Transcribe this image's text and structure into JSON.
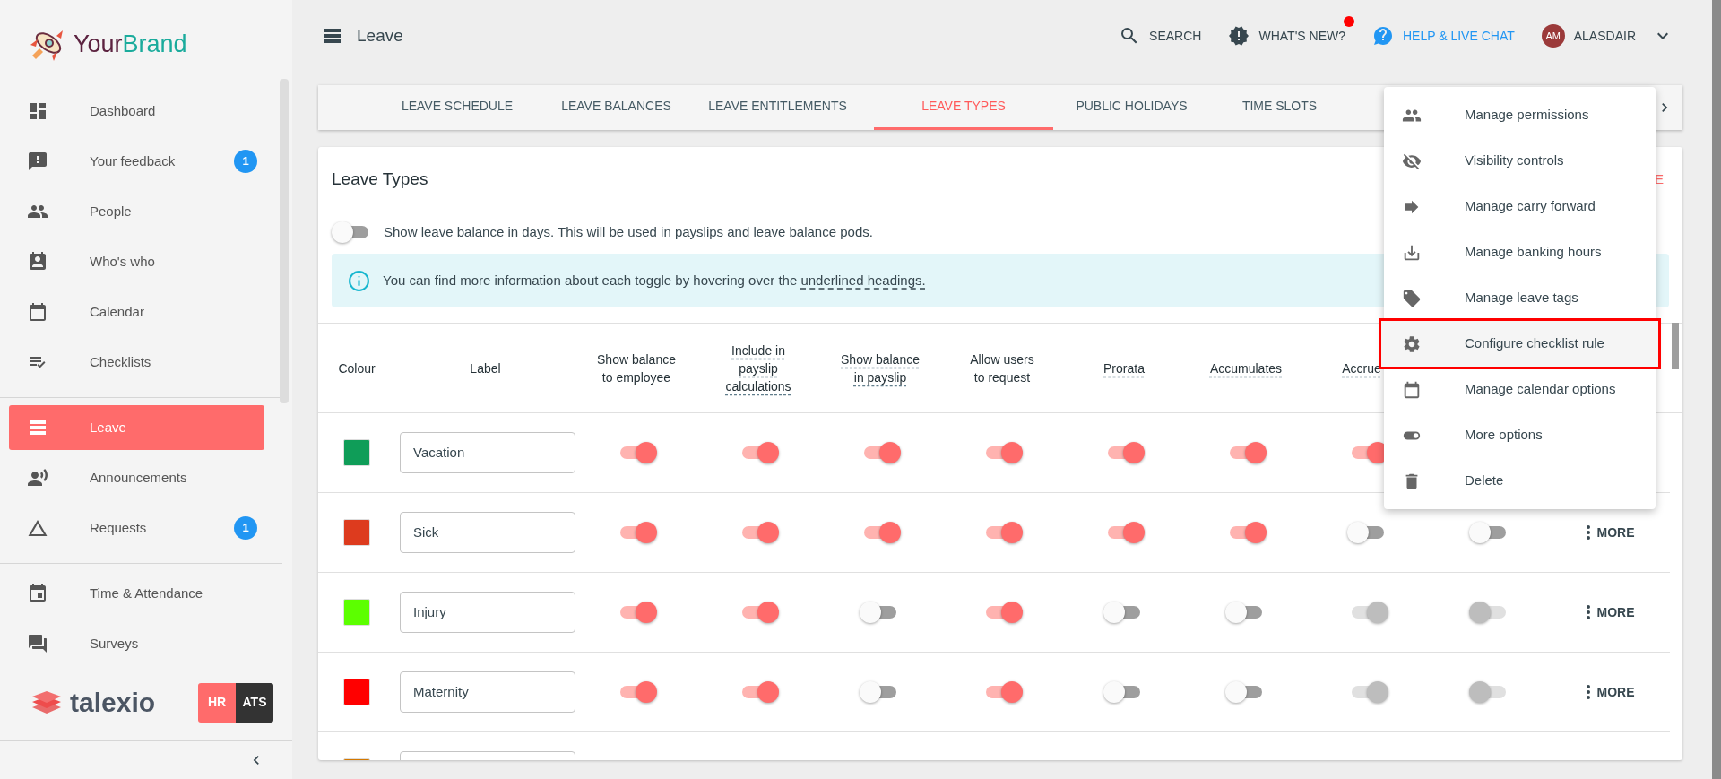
{
  "brand": {
    "name_first": "Your",
    "name_second": "Brand"
  },
  "sidebar": {
    "groups": [
      [
        {
          "label": "Dashboard",
          "selected": false
        },
        {
          "label": "Your feedback",
          "selected": false,
          "badge": "1"
        },
        {
          "label": "People",
          "selected": false
        },
        {
          "label": "Who's who",
          "selected": false
        },
        {
          "label": "Calendar",
          "selected": false
        },
        {
          "label": "Checklists",
          "selected": false
        }
      ],
      [
        {
          "label": "Leave",
          "selected": true
        },
        {
          "label": "Announcements",
          "selected": false
        },
        {
          "label": "Requests",
          "selected": false,
          "badge": "1"
        }
      ],
      [
        {
          "label": "Time & Attendance",
          "selected": false
        },
        {
          "label": "Surveys",
          "selected": false
        }
      ]
    ],
    "footer_logo": "talexio",
    "modules": [
      {
        "label": "HR",
        "selected": true
      },
      {
        "label": "ATS",
        "selected": false
      }
    ]
  },
  "header": {
    "title": "Leave",
    "actions": [
      {
        "kind": "search",
        "label": "SEARCH",
        "dot": false
      },
      {
        "kind": "news",
        "label": "WHAT'S NEW?",
        "dot": true
      },
      {
        "kind": "help",
        "label": "HELP & LIVE CHAT",
        "dot": false
      }
    ],
    "user": {
      "initials": "AM",
      "name": "ALASDAIR"
    }
  },
  "tabs": [
    {
      "label": "LEAVE SCHEDULE",
      "selected": false
    },
    {
      "label": "LEAVE BALANCES",
      "selected": false
    },
    {
      "label": "LEAVE ENTITLEMENTS",
      "selected": false
    },
    {
      "label": "LEAVE TYPES",
      "selected": true
    },
    {
      "label": "PUBLIC HOLIDAYS",
      "selected": false
    },
    {
      "label": "TIME SLOTS",
      "selected": false
    }
  ],
  "card": {
    "title": "Leave Types",
    "action_fragment": "E",
    "days_toggle": {
      "on": false,
      "label": "Show leave balance in days. This will be used in payslips and leave balance pods."
    },
    "info": {
      "text": "You can find more information about each toggle by hovering over the",
      "link": "underlined headings."
    },
    "columns": [
      {
        "label": "Colour",
        "underlined": false
      },
      {
        "label": "Label",
        "underlined": false
      },
      {
        "label": "Show balance\nto employee",
        "underlined": false
      },
      {
        "label": "Include in\npayslip\ncalculations",
        "underlined": true
      },
      {
        "label": "Show balance\nin payslip",
        "underlined": true
      },
      {
        "label": "Allow users\nto request",
        "underlined": false
      },
      {
        "label": "Prorata",
        "underlined": true
      },
      {
        "label": "Accumulates",
        "underlined": true
      },
      {
        "label": "Accrue",
        "underlined": true
      }
    ],
    "rows": [
      {
        "color": "#0f9d58",
        "label": "Vacation",
        "toggles": [
          {
            "on": true,
            "disabled": false
          },
          {
            "on": true,
            "disabled": false
          },
          {
            "on": true,
            "disabled": false
          },
          {
            "on": true,
            "disabled": false
          },
          {
            "on": true,
            "disabled": false
          },
          {
            "on": true,
            "disabled": false
          },
          {
            "on": true,
            "disabled": false
          }
        ]
      },
      {
        "color": "#dd3b1e",
        "label": "Sick",
        "toggles": [
          {
            "on": true,
            "disabled": false
          },
          {
            "on": true,
            "disabled": false
          },
          {
            "on": true,
            "disabled": false
          },
          {
            "on": true,
            "disabled": false
          },
          {
            "on": true,
            "disabled": false
          },
          {
            "on": true,
            "disabled": false
          },
          {
            "on": false,
            "disabled": false
          },
          {
            "on": false,
            "disabled": false
          }
        ],
        "more": "MORE"
      },
      {
        "color": "#5cff00",
        "label": "Injury",
        "toggles": [
          {
            "on": true,
            "disabled": false
          },
          {
            "on": true,
            "disabled": false
          },
          {
            "on": false,
            "disabled": false
          },
          {
            "on": true,
            "disabled": false
          },
          {
            "on": false,
            "disabled": false
          },
          {
            "on": false,
            "disabled": false
          },
          {
            "on": true,
            "disabled": true
          },
          {
            "on": false,
            "disabled": true
          }
        ],
        "more": "MORE"
      },
      {
        "color": "#ff0000",
        "label": "Maternity",
        "toggles": [
          {
            "on": true,
            "disabled": false
          },
          {
            "on": true,
            "disabled": false
          },
          {
            "on": false,
            "disabled": false
          },
          {
            "on": true,
            "disabled": false
          },
          {
            "on": false,
            "disabled": false
          },
          {
            "on": false,
            "disabled": false
          },
          {
            "on": true,
            "disabled": true
          },
          {
            "on": false,
            "disabled": true
          }
        ],
        "more": "MORE"
      },
      {
        "color": "#d47800",
        "toggles": []
      }
    ]
  },
  "menu": [
    {
      "label": "Manage permissions",
      "selected": false
    },
    {
      "label": "Visibility controls",
      "selected": false
    },
    {
      "label": "Manage carry forward",
      "selected": false
    },
    {
      "label": "Manage banking hours",
      "selected": false
    },
    {
      "label": "Manage leave tags",
      "selected": false
    },
    {
      "label": "Configure checklist rule",
      "selected": true
    },
    {
      "label": "Manage calendar options",
      "selected": false
    },
    {
      "label": "More options",
      "selected": false
    },
    {
      "label": "Delete",
      "selected": false
    }
  ]
}
